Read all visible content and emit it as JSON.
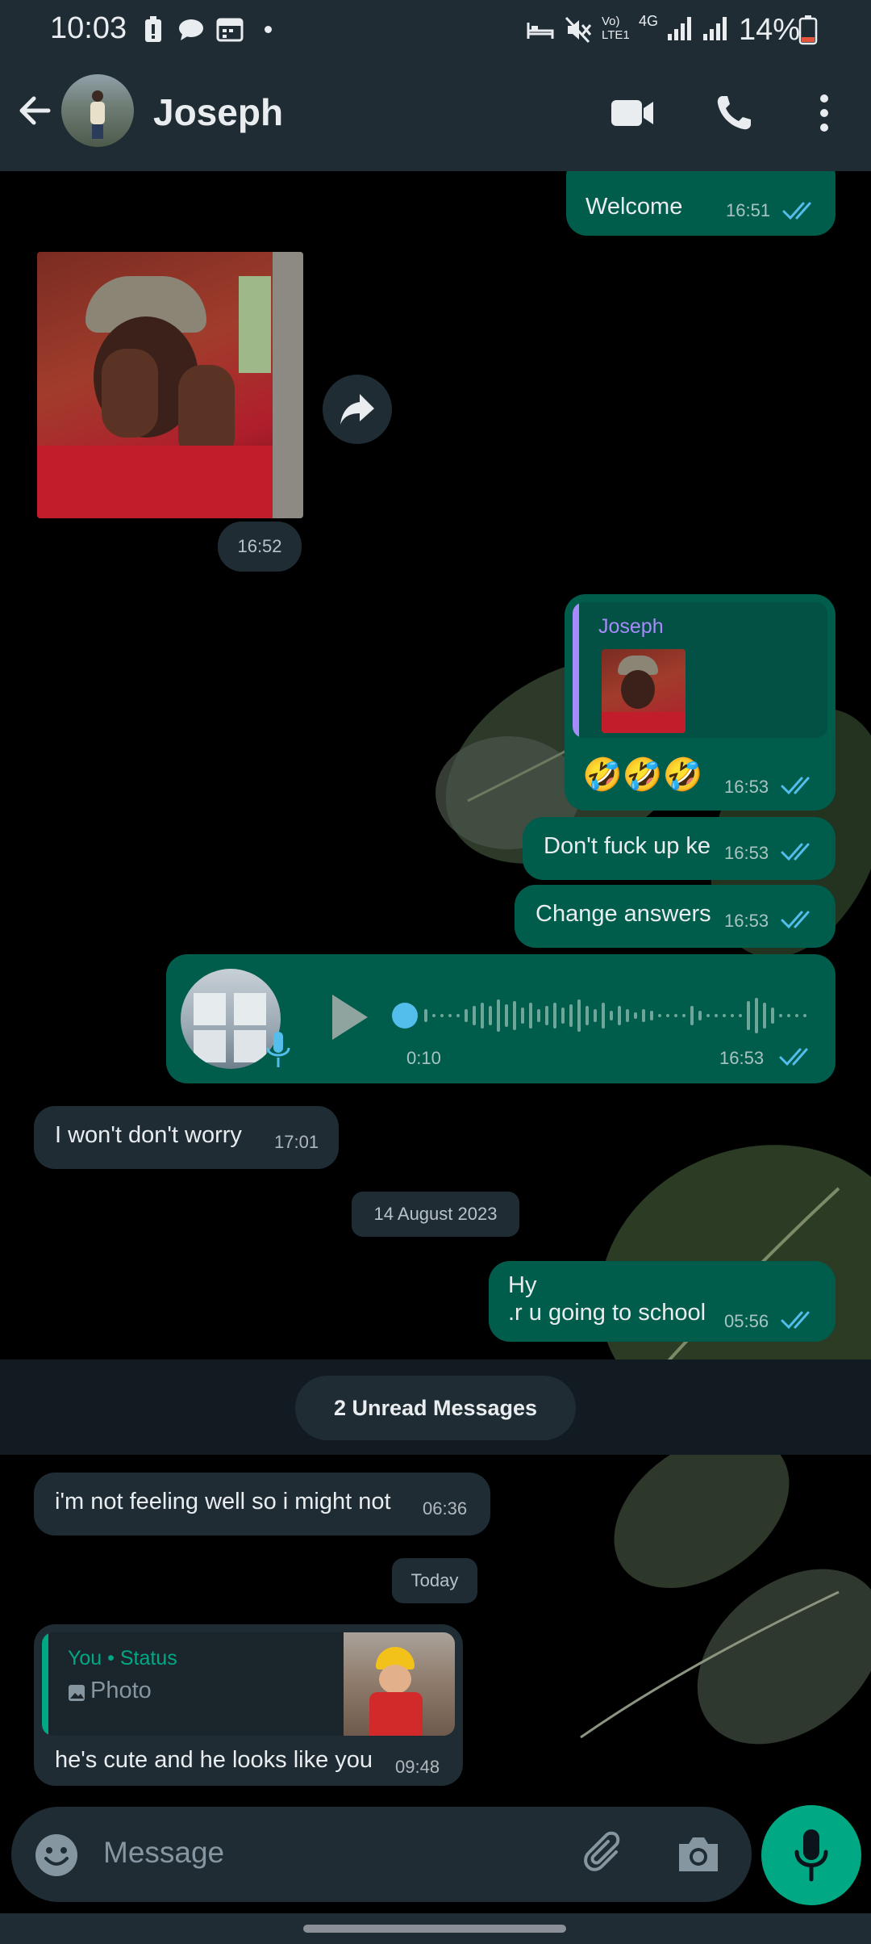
{
  "status_bar": {
    "time": "10:03",
    "network": "4G",
    "volte": "Vo) LTE1",
    "battery": "14%"
  },
  "header": {
    "contact_name": "Joseph"
  },
  "messages": [
    {
      "direction": "out",
      "text": "Welcome",
      "time": "16:51"
    },
    {
      "direction": "in",
      "type": "photo",
      "time": "16:52"
    },
    {
      "direction": "out",
      "type": "reply",
      "quoted_name": "Joseph",
      "text": "🤣🤣🤣",
      "time": "16:53"
    },
    {
      "direction": "out",
      "text": "Don't fuck up ke",
      "time": "16:53"
    },
    {
      "direction": "out",
      "text": "Change answers",
      "time": "16:53"
    },
    {
      "direction": "out",
      "type": "voice",
      "duration": "0:10",
      "time": "16:53"
    },
    {
      "direction": "in",
      "text": "I won't don't worry",
      "time": "17:01"
    },
    {
      "direction": "out",
      "text_line1": "Hy",
      "text_line2": ".r u going to school",
      "time": "05:56"
    },
    {
      "direction": "in",
      "text": "i'm not feeling well so i might not",
      "time": "06:36"
    },
    {
      "direction": "in",
      "type": "status_reply",
      "status_source": "You • Status",
      "status_kind": "Photo",
      "text": "he's cute and he looks like you",
      "time": "09:48"
    }
  ],
  "date_dividers": {
    "first": "14 August 2023",
    "second": "Today"
  },
  "unread_banner": "2 Unread Messages",
  "composer": {
    "placeholder": "Message"
  },
  "colors": {
    "outgoing_bubble": "#005c4b",
    "incoming_bubble": "#1f2c34",
    "read_ticks": "#53bdeb",
    "mic_button": "#00a884",
    "quote_accent": "#a78bfa"
  }
}
